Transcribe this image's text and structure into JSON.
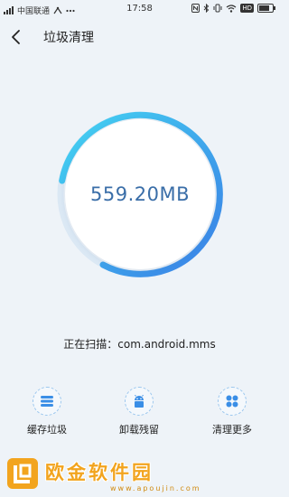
{
  "status_bar": {
    "carrier": "中国联通",
    "time": "17:58",
    "hd_badge": "HD"
  },
  "header": {
    "title": "垃圾清理"
  },
  "scan": {
    "size": "559.20MB",
    "text": "正在扫描：com.android.mms"
  },
  "actions": [
    {
      "label": "缓存垃圾",
      "icon": "list-icon"
    },
    {
      "label": "卸载残留",
      "icon": "android-icon"
    },
    {
      "label": "清理更多",
      "icon": "grid-icon"
    }
  ],
  "watermark": {
    "name": "欧金软件园",
    "url": "www.apoujin.com"
  },
  "colors": {
    "accent": "#3a8ee6",
    "ring_start": "#3fd0f0",
    "ring_end": "#3c7fe6",
    "logo": "#f2a41e"
  }
}
